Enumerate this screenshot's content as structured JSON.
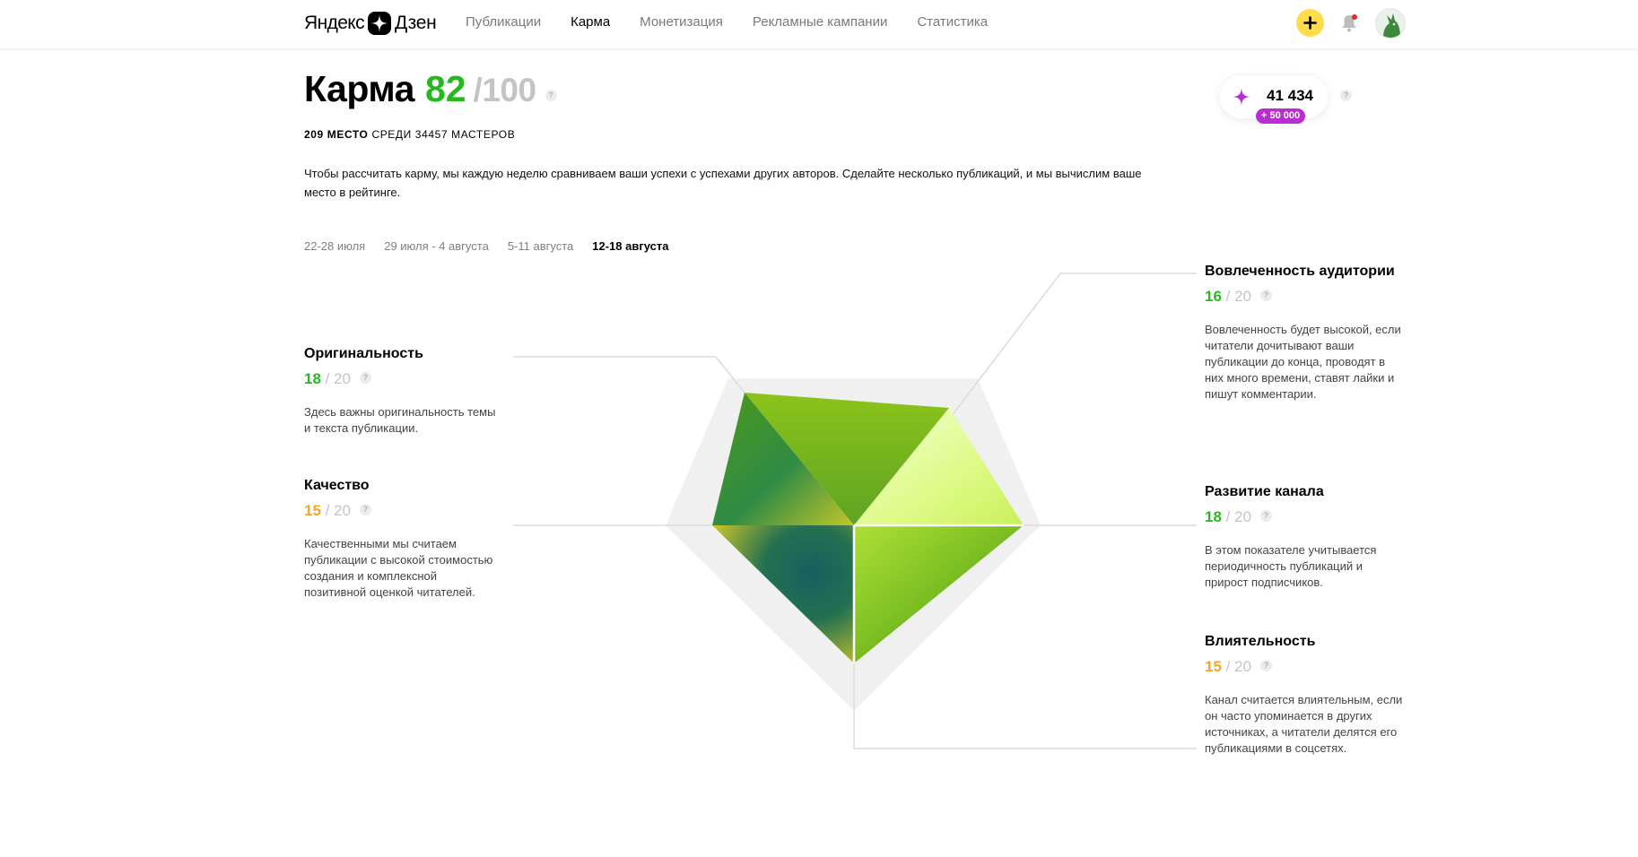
{
  "header": {
    "logo": {
      "word1": "Яндекс",
      "word2": "Дзен"
    },
    "nav": [
      {
        "label": "Публикации",
        "active": false
      },
      {
        "label": "Карма",
        "active": true
      },
      {
        "label": "Монетизация",
        "active": false
      },
      {
        "label": "Рекламные кампании",
        "active": false
      },
      {
        "label": "Статистика",
        "active": false
      }
    ],
    "icons": {
      "add": "plus-icon",
      "notifications": "bell-icon",
      "avatar": "avatar-icon"
    }
  },
  "karma": {
    "label": "Карма",
    "score": "82",
    "max": "/100",
    "rank_place": "209 МЕСТО",
    "rank_rest": "СРЕДИ 34457 МАСТЕРОВ",
    "intro": "Чтобы рассчитать карму, мы каждую неделю сравниваем ваши успехи с успехами других авторов. Сделайте несколько публикаций, и мы вычислим ваше место в рейтинге.",
    "help_glyph": "?"
  },
  "weeks": [
    {
      "label": "22-28 июля",
      "active": false
    },
    {
      "label": "29 июля - 4 августа",
      "active": false
    },
    {
      "label": "5-11 августа",
      "active": false
    },
    {
      "label": "12-18 августа",
      "active": true
    }
  ],
  "balance": {
    "value": "41 434",
    "bonus": "+ 50 000",
    "icon": "diamond-icon"
  },
  "metrics": {
    "originality": {
      "title": "Оригинальность",
      "score": "18",
      "max": "20",
      "desc": "Здесь важны оригинальность темы и текста публикации."
    },
    "quality": {
      "title": "Качество",
      "score": "15",
      "max": "20",
      "desc": "Качественными мы считаем публикации с высокой стоимостью создания и комплексной позитивной оценкой читателей."
    },
    "engagement": {
      "title": "Вовлеченность аудитории",
      "score": "16",
      "max": "20",
      "desc": "Вовлеченность будет высокой, если читатели дочитывают ваши публикации до конца, проводят в них много времени, ставят лайки и пишут комментарии."
    },
    "growth": {
      "title": "Развитие канала",
      "score": "18",
      "max": "20",
      "desc": "В этом показателе учитывается периодичность публикаций и прирост подписчиков."
    },
    "influence": {
      "title": "Влиятельность",
      "score": "15",
      "max": "20",
      "desc": "Канал считается влиятельным, если он часто упоминается в других источниках, а читатели делятся его публикациями в соцсетях."
    }
  },
  "colors": {
    "score_green": "#27b81f",
    "score_orange": "#f5a623",
    "add_button": "#ffdb4d",
    "bonus_badge": "#b92ed1"
  }
}
